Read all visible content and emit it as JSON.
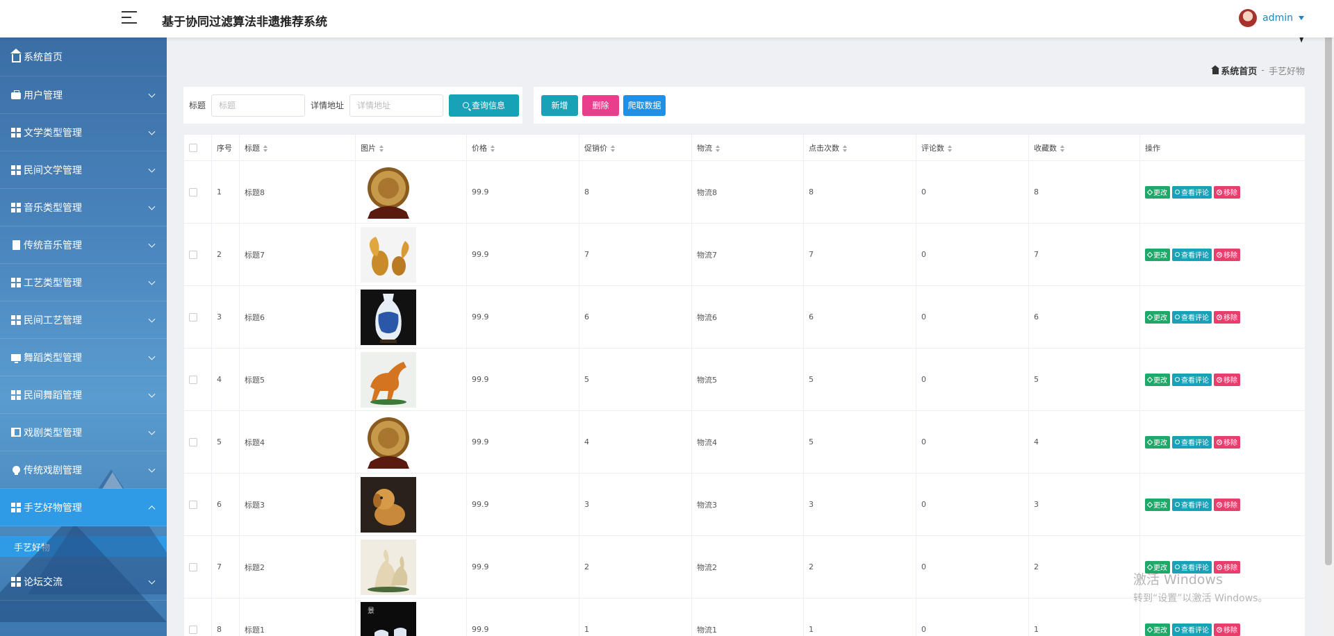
{
  "header": {
    "title": "基于协同过滤算法非遗推荐系统",
    "username": "admin"
  },
  "sidebar": {
    "items": [
      {
        "label": "系统首页",
        "icon": "home-icon"
      },
      {
        "label": "用户管理",
        "icon": "briefcase-icon"
      },
      {
        "label": "文学类型管理",
        "icon": "grid-icon"
      },
      {
        "label": "民间文学管理",
        "icon": "grid-icon"
      },
      {
        "label": "音乐类型管理",
        "icon": "grid-icon"
      },
      {
        "label": "传统音乐管理",
        "icon": "clipboard-icon"
      },
      {
        "label": "工艺类型管理",
        "icon": "grid-icon"
      },
      {
        "label": "民间工艺管理",
        "icon": "grid-icon"
      },
      {
        "label": "舞蹈类型管理",
        "icon": "monitor-icon"
      },
      {
        "label": "民间舞蹈管理",
        "icon": "grid-icon"
      },
      {
        "label": "戏剧类型管理",
        "icon": "book-icon"
      },
      {
        "label": "传统戏剧管理",
        "icon": "bulb-icon"
      },
      {
        "label": "手艺好物管理",
        "icon": "grid-icon"
      },
      {
        "label": "论坛交流",
        "icon": "grid-icon"
      }
    ],
    "submenu": {
      "label": "手艺好物"
    }
  },
  "breadcrumb": {
    "home": "系统首页",
    "separator": "-",
    "current": "手艺好物"
  },
  "search": {
    "title_label": "标题",
    "title_placeholder": "标题",
    "address_label": "详情地址",
    "address_placeholder": "详情地址",
    "search_button": "查询信息"
  },
  "actions": {
    "add": "新增",
    "delete": "删除",
    "crawl": "爬取数据"
  },
  "table": {
    "headers": [
      "序号",
      "标题",
      "图片",
      "价格",
      "促销价",
      "物流",
      "点击次数",
      "评论数",
      "收藏数",
      "操作"
    ],
    "op_labels": {
      "edit": "更改",
      "comments": "查看评论",
      "remove": "移除"
    },
    "rows": [
      {
        "no": "1",
        "title": "标题8",
        "price": "99.9",
        "promo": "8",
        "logistics": "物流8",
        "clicks": "8",
        "comments": "0",
        "favorites": "8",
        "image": "carved-plate"
      },
      {
        "no": "2",
        "title": "标题7",
        "price": "99.9",
        "promo": "7",
        "logistics": "物流7",
        "clicks": "7",
        "comments": "0",
        "favorites": "7",
        "image": "squirrel-figurines"
      },
      {
        "no": "3",
        "title": "标题6",
        "price": "99.9",
        "promo": "6",
        "logistics": "物流6",
        "clicks": "6",
        "comments": "0",
        "favorites": "6",
        "image": "blue-white-vase"
      },
      {
        "no": "4",
        "title": "标题5",
        "price": "99.9",
        "promo": "5",
        "logistics": "物流5",
        "clicks": "5",
        "comments": "0",
        "favorites": "5",
        "image": "horse-statue"
      },
      {
        "no": "5",
        "title": "标题4",
        "price": "99.9",
        "promo": "4",
        "logistics": "物流4",
        "clicks": "5",
        "comments": "0",
        "favorites": "4",
        "image": "carved-plate"
      },
      {
        "no": "6",
        "title": "标题3",
        "price": "99.9",
        "promo": "3",
        "logistics": "物流3",
        "clicks": "3",
        "comments": "0",
        "favorites": "3",
        "image": "wood-dog"
      },
      {
        "no": "7",
        "title": "标题2",
        "price": "99.9",
        "promo": "2",
        "logistics": "物流2",
        "clicks": "2",
        "comments": "0",
        "favorites": "2",
        "image": "crane-ornament"
      },
      {
        "no": "8",
        "title": "标题1",
        "price": "99.9",
        "promo": "1",
        "logistics": "物流1",
        "clicks": "1",
        "comments": "0",
        "favorites": "1",
        "image": "porcelain-set"
      }
    ]
  },
  "watermark": {
    "title": "激活 Windows",
    "subtitle": "转到“设置”以激活 Windows。"
  },
  "colors": {
    "accent": "#17a2b8",
    "danger": "#e83e8c",
    "primary": "#1e90e8",
    "sidebar_active": "#2f9be6"
  }
}
